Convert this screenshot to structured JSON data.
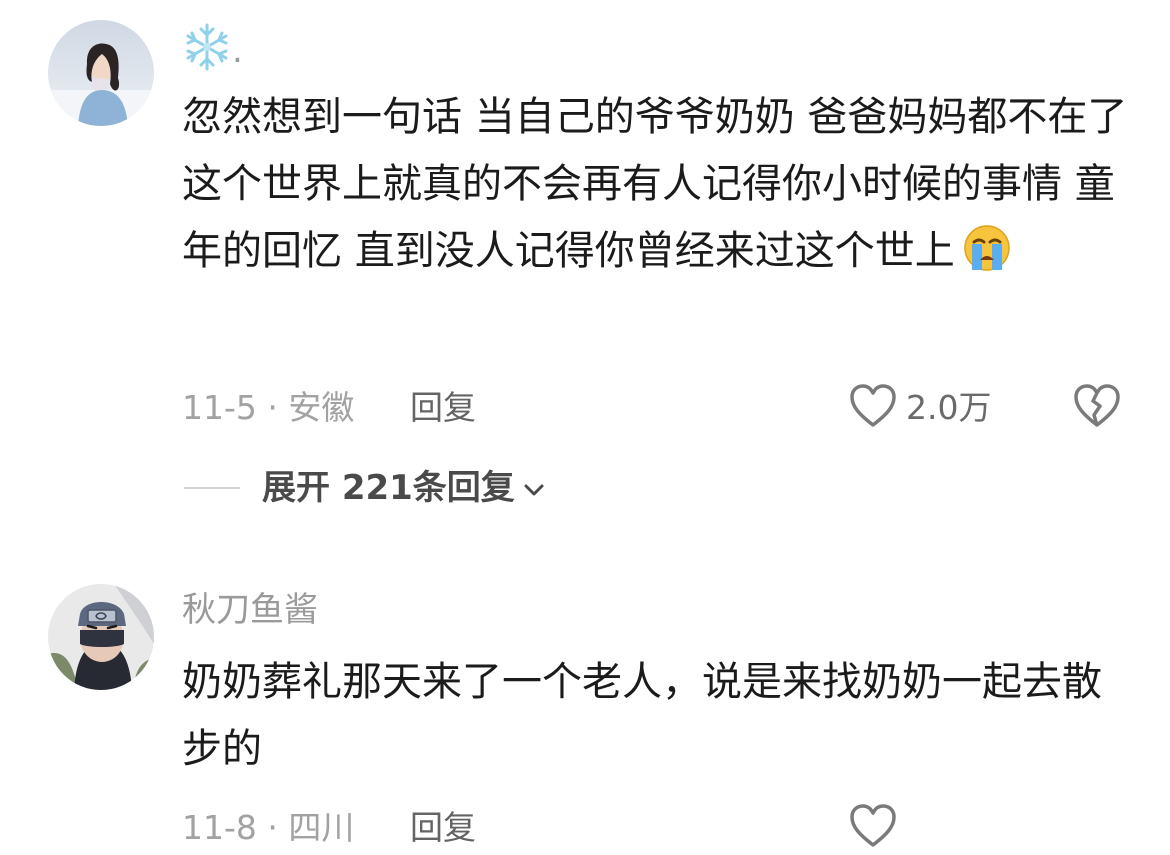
{
  "comments": [
    {
      "username": "❄️.",
      "text": "忽然想到一句话 当自己的爷爷奶奶 爸爸妈妈都不在了 这个世界上就真的不会再有人记得你小时候的事情 童年的回忆 直到没人记得你曾经来过这个世上",
      "emoji": "crying-face",
      "date_location": "11-5 · 安徽",
      "reply_label": "回复",
      "like_count": "2.0万",
      "expand_label": "展开 221条回复"
    },
    {
      "username": "秋刀鱼酱",
      "text": "奶奶葬礼那天来了一个老人，说是来找奶奶一起去散步的",
      "date_location": "11-8 · 四川",
      "reply_label": "回复"
    }
  ],
  "colors": {
    "primary_text": "#1b1b1b",
    "secondary_text": "#9a9a9a",
    "icon": "#7a7a7a"
  },
  "icons": [
    "heart-outline-icon",
    "broken-heart-icon",
    "chevron-down-icon",
    "crying-face-emoji"
  ]
}
